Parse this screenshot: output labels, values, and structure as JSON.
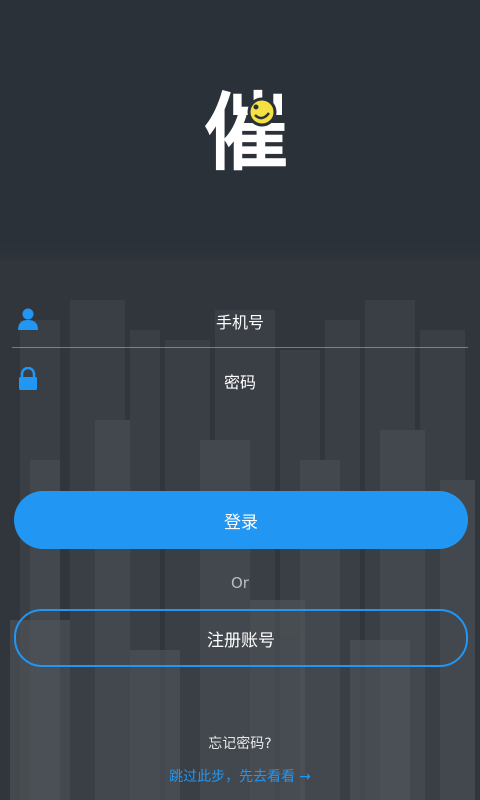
{
  "app": {
    "logo_glyph": "催",
    "logo_color": "#ffffff",
    "logo_badge_color": "#f5e142"
  },
  "login_form": {
    "phone_placeholder": "手机号",
    "password_placeholder": "密码",
    "login_label": "登录",
    "or_label": "Or",
    "register_label": "注册账号",
    "forgot_label": "忘记密码?",
    "skip_label": "跳过此步，先去看看",
    "skip_arrow": "→"
  },
  "colors": {
    "accent": "#2196f3",
    "background": "#2b3138"
  },
  "icons": {
    "phone_field": "user-icon",
    "password_field": "lock-icon"
  }
}
